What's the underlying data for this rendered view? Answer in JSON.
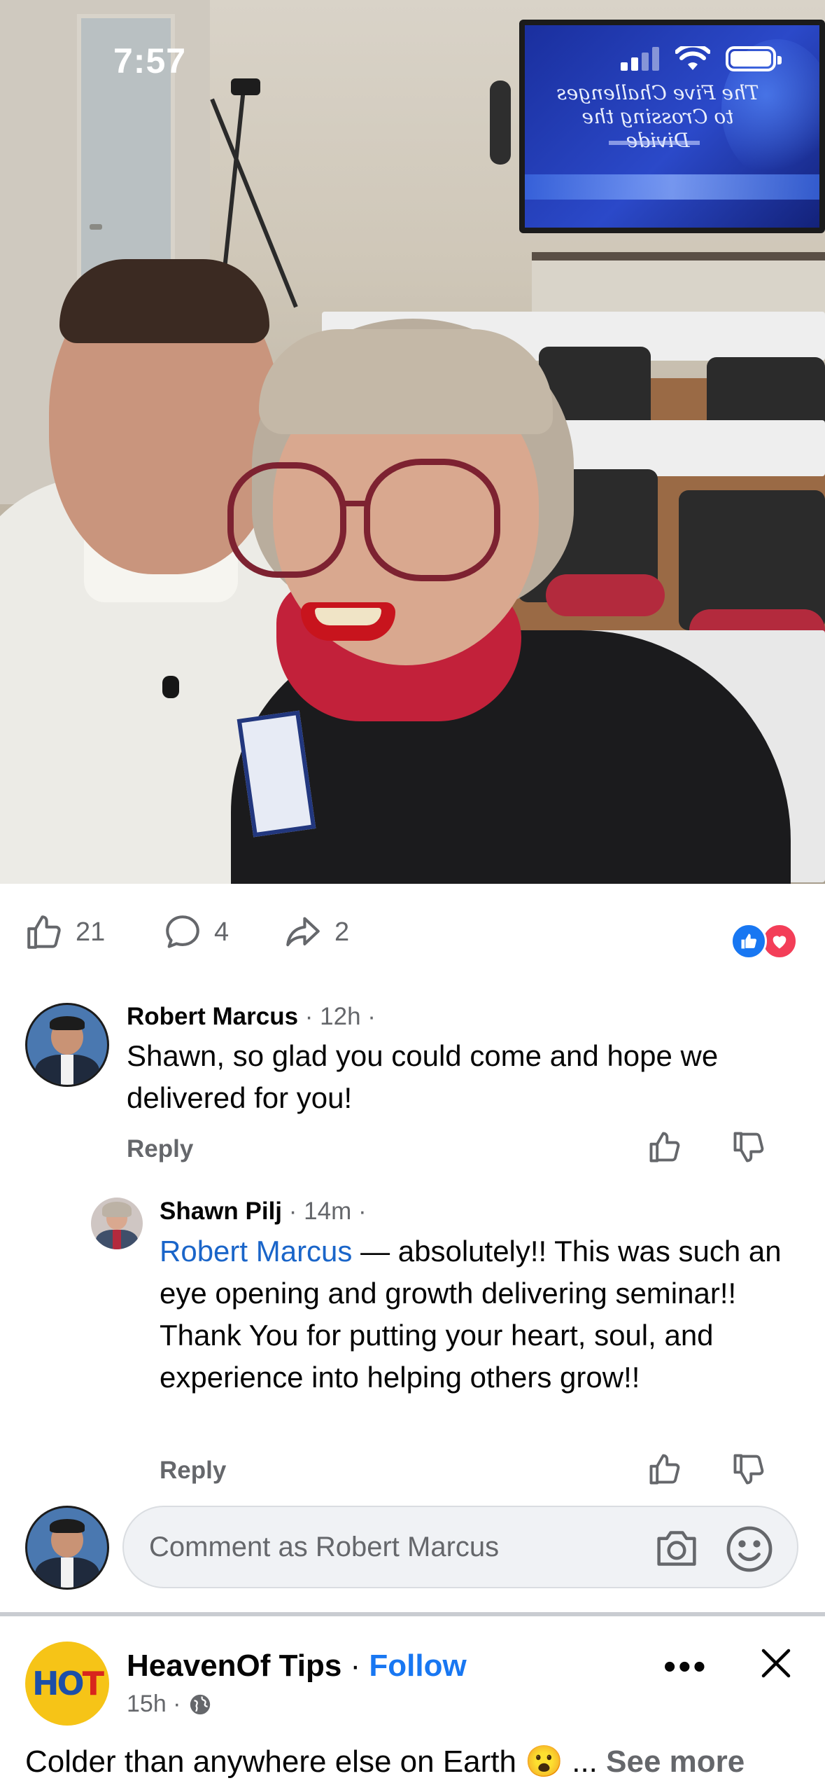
{
  "status_bar": {
    "time": "7:57"
  },
  "photo": {
    "screen_text": "The Five Challenges to Crossing the Divide"
  },
  "actions": {
    "like_count": "21",
    "comment_count": "4",
    "share_count": "2"
  },
  "comments": [
    {
      "author": "Robert Marcus",
      "meta": "· 12h ·",
      "text": "Shawn, so glad you could come and hope we delivered for you!",
      "reply_label": "Reply"
    },
    {
      "author": "Shawn Pilj",
      "meta": "· 14m ·",
      "mention": "Robert Marcus",
      "text": " — absolutely!!  This was such an eye opening and growth delivering seminar!!  Thank You for putting your heart, soul, and experience into helping others grow!!",
      "reply_label": "Reply"
    }
  ],
  "comment_input": {
    "placeholder": "Comment as Robert Marcus"
  },
  "next_post": {
    "page_name": "HeavenOf Tips",
    "separator": " · ",
    "follow_label": "Follow",
    "time": "15h ·",
    "avatar_text_1": "HO",
    "avatar_text_2": "T",
    "caption": "Colder than anywhere else on Earth 😮",
    "ellipsis": "...",
    "see_more": "See more"
  },
  "colors": {
    "accent": "#1877f2",
    "mention": "#1a65c9",
    "love": "#f33e58",
    "secondary_text": "#65676b"
  }
}
